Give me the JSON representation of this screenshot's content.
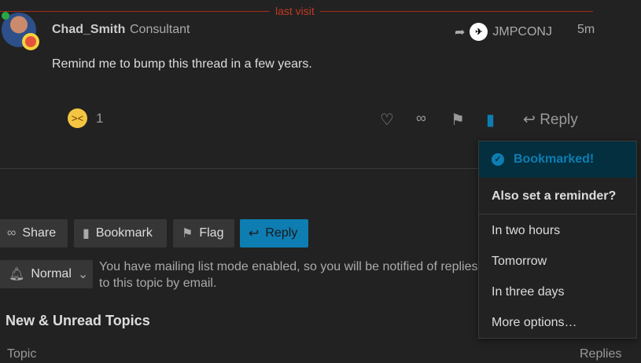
{
  "divider": {
    "label": "last visit"
  },
  "post": {
    "username": "Chad_Smith",
    "user_title": "Consultant",
    "reply_to_user": "JMPCONJ",
    "time": "5m",
    "body": "Remind me to bump this thread in a few years.",
    "reaction_count": "1",
    "reply_label": "Reply"
  },
  "footer": {
    "share": "Share",
    "bookmark": "Bookmark",
    "flag": "Flag",
    "reply": "Reply",
    "notification_level": "Normal",
    "notification_msg": "You have mailing list mode enabled, so you will be notified of replies to this topic by email."
  },
  "suggested": {
    "title": "New & Unread Topics",
    "col_topic": "Topic",
    "col_replies": "Replies"
  },
  "bookmark_menu": {
    "status": "Bookmarked!",
    "question": "Also set a reminder?",
    "options": [
      "In two hours",
      "Tomorrow",
      "In three days",
      "More options…"
    ]
  },
  "colors": {
    "accent": "#0e7db2",
    "last_visit": "#c0391f"
  }
}
